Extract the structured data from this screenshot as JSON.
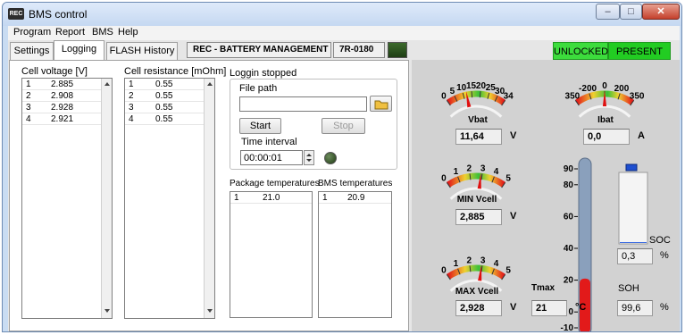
{
  "window": {
    "title": "BMS control",
    "icon_text": "REC",
    "controls": {
      "minimize": "–",
      "maximize": "□",
      "close": "✕"
    }
  },
  "menu": [
    "Program",
    "Report",
    "BMS",
    "Help"
  ],
  "tabs": [
    "Settings",
    "Logging",
    "FLASH History"
  ],
  "active_tab": "Logging",
  "header": {
    "device_name": "REC - BATTERY MANAGEMENT",
    "model": "7R-0180"
  },
  "status": {
    "lock": "UNLOCKED",
    "presence": "PRESENT"
  },
  "cell_voltage": {
    "label": "Cell voltage [V]",
    "rows": [
      [
        "1",
        "2.885"
      ],
      [
        "2",
        "2.908"
      ],
      [
        "3",
        "2.928"
      ],
      [
        "4",
        "2.921"
      ]
    ]
  },
  "cell_resistance": {
    "label": "Cell resistance [mOhm]",
    "rows": [
      [
        "1",
        "0.55"
      ],
      [
        "2",
        "0.55"
      ],
      [
        "3",
        "0.55"
      ],
      [
        "4",
        "0.55"
      ]
    ]
  },
  "logging": {
    "status": "Loggin stopped",
    "file_path_label": "File path",
    "file_path_value": "",
    "start_label": "Start",
    "stop_label": "Stop",
    "time_interval_label": "Time interval",
    "time_interval_value": "00:00:01"
  },
  "package_temperatures": {
    "label": "Package temperatures",
    "rows": [
      [
        "1",
        "21.0"
      ]
    ]
  },
  "bms_temperatures": {
    "label": "BMS temperatures",
    "rows": [
      [
        "1",
        "20.9"
      ]
    ]
  },
  "gauges": {
    "vbat": {
      "label": "Vbat",
      "value": "11,64",
      "unit": "V",
      "min": 0,
      "max": 34,
      "ticks": [
        "0",
        "5",
        "10",
        "15",
        "20",
        "25",
        "30",
        "34"
      ],
      "reading": 11.64
    },
    "ibat": {
      "label": "Ibat",
      "value": "0,0",
      "unit": "A",
      "min": -350,
      "max": 350,
      "ticks": [
        "350",
        "-200",
        "0",
        "200",
        "350"
      ],
      "reading": 0
    },
    "min_vcell": {
      "label": "MIN Vcell",
      "value": "2,885",
      "unit": "V",
      "min": 0,
      "max": 5,
      "ticks": [
        "0",
        "1",
        "2",
        "3",
        "4",
        "5"
      ],
      "reading": 2.885
    },
    "max_vcell": {
      "label": "MAX Vcell",
      "value": "2,928",
      "unit": "V",
      "min": 0,
      "max": 5,
      "ticks": [
        "0",
        "1",
        "2",
        "3",
        "4",
        "5"
      ],
      "reading": 2.928
    }
  },
  "thermometer": {
    "label": "Tmax",
    "value": "21",
    "unit": "°C",
    "ticks": [
      "90",
      "80",
      "60",
      "40",
      "20",
      "0",
      "-10"
    ],
    "reading": 21,
    "min": -10,
    "max": 90
  },
  "soc": {
    "label": "SOC",
    "value": "0,3",
    "unit": "%",
    "fraction": 0.003
  },
  "soh": {
    "label": "SOH",
    "value": "99,6",
    "unit": "%"
  },
  "colors": {
    "status_green": "#3cdc3c",
    "status_green_dark": "#22b822",
    "led_dark_green": "#2e5a1e",
    "needle_red": "#e01010",
    "thermo_red": "#e21a1a"
  }
}
